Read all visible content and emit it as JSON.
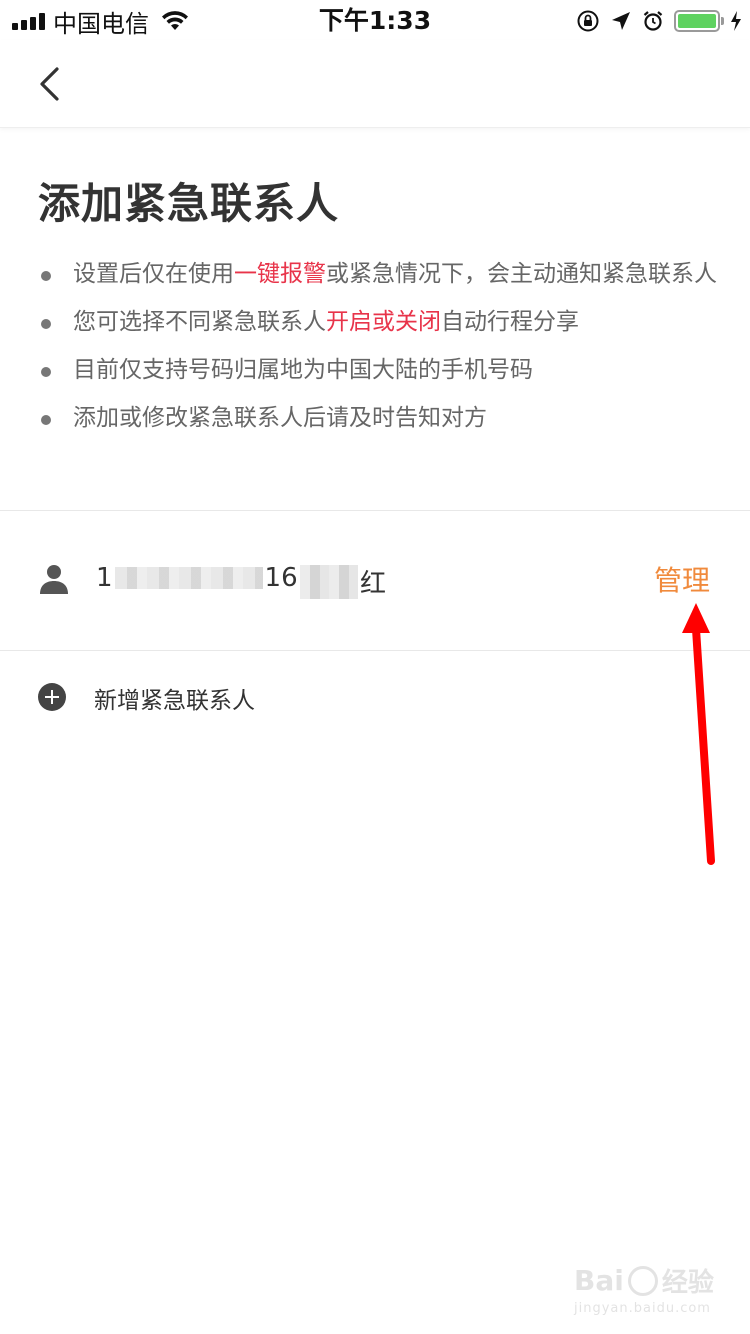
{
  "status_bar": {
    "carrier": "中国电信",
    "time": "下午1:33",
    "battery_color": "#5fd260"
  },
  "nav": {
    "back_icon": "chevron-left-icon"
  },
  "page": {
    "title": "添加紧急联系人"
  },
  "notes": [
    {
      "before": "设置后仅在使用",
      "highlight": "一键报警",
      "after": "或紧急情况下，会主动通知紧急联系人"
    },
    {
      "before": "您可选择不同紧急联系人",
      "highlight": "开启或关闭",
      "after": "自动行程分享"
    },
    {
      "before": "目前仅支持号码归属地为中国大陆的手机号码",
      "highlight": "",
      "after": ""
    },
    {
      "before": "添加或修改紧急联系人后请及时告知对方",
      "highlight": "",
      "after": ""
    }
  ],
  "contact": {
    "icon": "person-icon",
    "phone_prefix": "1",
    "phone_suffix": "16",
    "name_visible": "红",
    "manage_label": "管理"
  },
  "add_contact": {
    "icon": "plus-circle-icon",
    "label": "新增紧急联系人"
  },
  "watermark": {
    "brand": "Bai",
    "brand_cn": "经验",
    "url": "jingyan.baidu.com"
  },
  "colors": {
    "highlight": "#e8344a",
    "manage": "#f08a3c",
    "annotation_arrow": "#ff0000"
  }
}
